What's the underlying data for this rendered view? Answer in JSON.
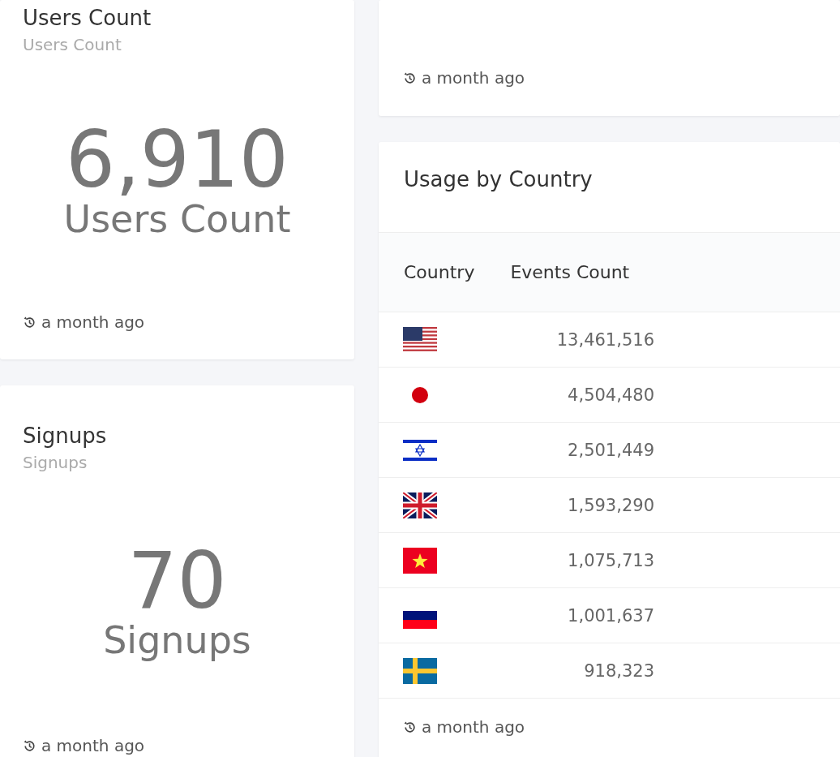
{
  "widgets": [
    {
      "title": "Users Count",
      "subtitle": "Users Count",
      "value": "6,910",
      "label": "Users Count",
      "updated": "a month ago"
    },
    {
      "title": "Signups",
      "subtitle": "Signups",
      "value": "70",
      "label": "Signups",
      "updated": "a month ago"
    }
  ],
  "top_right_widget": {
    "updated": "a month ago"
  },
  "country_table": {
    "title": "Usage by Country",
    "columns": [
      "Country",
      "Events Count"
    ],
    "rows": [
      {
        "kind": "us",
        "events": "13,461,516"
      },
      {
        "kind": "jp",
        "events": "4,504,480"
      },
      {
        "kind": "il",
        "events": "2,501,449"
      },
      {
        "kind": "gb",
        "events": "1,593,290"
      },
      {
        "kind": "vn",
        "events": "1,075,713"
      },
      {
        "kind": "ru",
        "events": "1,001,637"
      },
      {
        "kind": "se",
        "events": "918,323"
      }
    ],
    "updated": "a month ago"
  }
}
